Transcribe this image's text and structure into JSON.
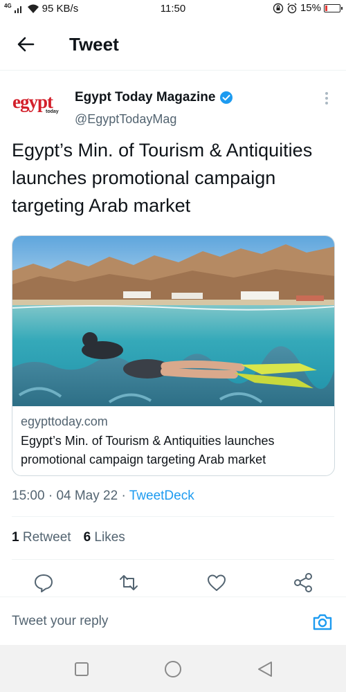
{
  "status_bar": {
    "network_type": "4G",
    "speed": "95 KB/s",
    "time": "11:50",
    "battery": "15%",
    "battery_level": 0.15,
    "battery_color": "#e53935"
  },
  "header": {
    "back_icon": "arrow-left-icon",
    "title": "Tweet"
  },
  "author": {
    "logo_text": "egypt",
    "logo_subtext": "today",
    "name": "Egypt Today Magazine",
    "verified_icon": "verified-badge-icon",
    "handle": "@EgyptTodayMag",
    "more_icon": "more-vertical-icon"
  },
  "tweet": {
    "text": "Egypt’s Min. of Tourism & Antiquities launches promotional campaign targeting Arab market"
  },
  "link_card": {
    "image_icon": "snorkeler-photo",
    "domain": "egypttoday.com",
    "title": "Egypt’s Min. of Tourism & Antiquities launches promotional campaign targeting Arab market"
  },
  "meta": {
    "time": "15:00",
    "separator": "·",
    "date": "04 May 22",
    "source": "TweetDeck"
  },
  "stats": {
    "retweets_count": "1",
    "retweets_label": "Retweet",
    "likes_count": "6",
    "likes_label": "Likes"
  },
  "actions": [
    "reply-icon",
    "retweet-icon",
    "like-icon",
    "share-icon"
  ],
  "reply_bar": {
    "placeholder": "Tweet your reply",
    "camera_icon": "camera-icon"
  },
  "nav_bar": [
    "recents-square-icon",
    "home-circle-icon",
    "back-triangle-icon"
  ],
  "colors": {
    "accent": "#1d9bf0",
    "text_primary": "#0f1419",
    "text_secondary": "#536471",
    "logo_red": "#d3202b"
  }
}
